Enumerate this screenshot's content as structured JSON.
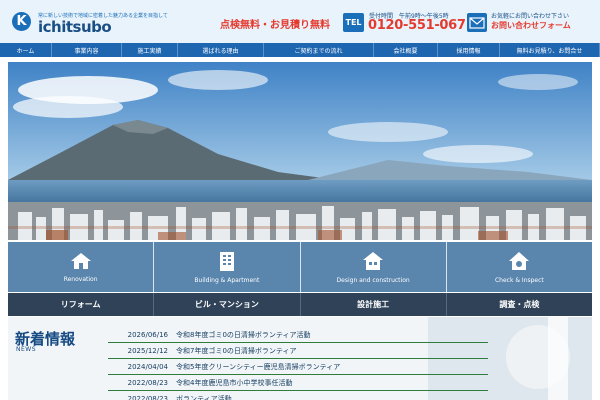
{
  "header": {
    "logo_letter": "K",
    "tagline": "常に新しい技術で地域に密着した魅力ある企業を目指して",
    "brand": "ichitsubo",
    "free_quote": "点検無料・お見積り無料",
    "tel_badge": "TEL",
    "tel_hours": "受付時間　午前9時〜午後5時",
    "tel_number": "0120-551-067",
    "contact_top": "お気軽にお問い合わせ下さい",
    "contact_form": "お問い合わせフォーム"
  },
  "nav": [
    {
      "label": "ホーム",
      "name": "nav-home"
    },
    {
      "label": "事業内容",
      "name": "nav-business"
    },
    {
      "label": "施工実績",
      "name": "nav-works"
    },
    {
      "label": "選ばれる理由",
      "name": "nav-reasons"
    },
    {
      "label": "ご契約までの流れ",
      "name": "nav-flow"
    },
    {
      "label": "会社概要",
      "name": "nav-company"
    },
    {
      "label": "採用情報",
      "name": "nav-recruit"
    },
    {
      "label": "無料お見積り、お問合せ",
      "name": "nav-contact"
    }
  ],
  "tiles": [
    {
      "label": "Renovation",
      "icon": "house-icon"
    },
    {
      "label": "Building & Apartment",
      "icon": "building-icon"
    },
    {
      "label": "Design and construction",
      "icon": "design-icon"
    },
    {
      "label": "Check & Inspect",
      "icon": "inspect-house-icon"
    }
  ],
  "services": [
    "リフォーム",
    "ビル・マンション",
    "設計施工",
    "調査・点検"
  ],
  "news": {
    "title": "新着情報",
    "sub": "NEWS",
    "items": [
      {
        "date": "2026/06/16",
        "text": "令和8年度ゴミ0の日清掃ボランティア活動"
      },
      {
        "date": "2025/12/12",
        "text": "令和7年度ゴミ0の日清掃ボランティア"
      },
      {
        "date": "2024/04/04",
        "text": "令和5年度クリーンシティー鹿児島清掃ボランティア"
      },
      {
        "date": "2022/08/23",
        "text": "令和4年度鹿児島市小中学校事任活動"
      },
      {
        "date": "2022/08/23",
        "text": "ボランティア活動"
      }
    ]
  },
  "colors": {
    "brand": "#1f66b1",
    "accent_red": "#e53a2f",
    "dark_bar": "#2f4258",
    "tile": "#5a85ad"
  }
}
